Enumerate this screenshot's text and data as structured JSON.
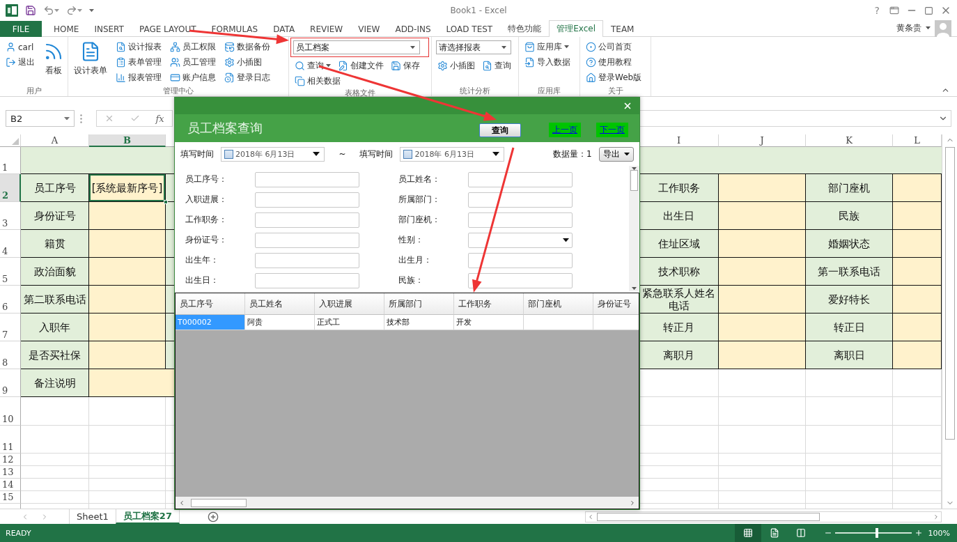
{
  "window": {
    "title": "Book1 - Excel",
    "help": "?"
  },
  "ribbon_tabs": [
    {
      "label": "FILE",
      "kind": "file",
      "selected": false
    },
    {
      "label": "HOME",
      "kind": "tab",
      "selected": false
    },
    {
      "label": "INSERT",
      "kind": "tab",
      "selected": false
    },
    {
      "label": "PAGE LAYOUT",
      "kind": "tab",
      "selected": false
    },
    {
      "label": "FORMULAS",
      "kind": "tab",
      "selected": false
    },
    {
      "label": "DATA",
      "kind": "tab",
      "selected": false
    },
    {
      "label": "REVIEW",
      "kind": "tab",
      "selected": false
    },
    {
      "label": "VIEW",
      "kind": "tab",
      "selected": false
    },
    {
      "label": "ADD-INS",
      "kind": "tab",
      "selected": false
    },
    {
      "label": "LOAD TEST",
      "kind": "tab",
      "selected": false
    },
    {
      "label": "特色功能",
      "kind": "tab",
      "selected": false
    },
    {
      "label": "管理Excel",
      "kind": "tab",
      "selected": true
    },
    {
      "label": "TEAM",
      "kind": "tab",
      "selected": false
    }
  ],
  "account": {
    "name": "黄条贵"
  },
  "ribbon_groups": [
    {
      "label": "用户",
      "columns": [
        [
          {
            "kind": "small",
            "label": "carl"
          },
          {
            "kind": "small",
            "label": "退出"
          }
        ],
        [
          {
            "kind": "large",
            "label": "看板"
          }
        ]
      ]
    },
    {
      "label": "管理中心",
      "columns": [
        [
          {
            "kind": "large",
            "label": "设计表单"
          }
        ],
        [
          {
            "kind": "small",
            "label": "设计报表"
          },
          {
            "kind": "small",
            "label": "表单管理"
          },
          {
            "kind": "small",
            "label": "报表管理"
          }
        ],
        [
          {
            "kind": "small",
            "label": "员工权限"
          },
          {
            "kind": "small",
            "label": "员工管理"
          },
          {
            "kind": "small",
            "label": "账户信息"
          }
        ],
        [
          {
            "kind": "small",
            "label": "数据备份"
          },
          {
            "kind": "small",
            "label": "小插图"
          },
          {
            "kind": "small",
            "label": "登录日志"
          }
        ]
      ]
    },
    {
      "label": "表格文件",
      "columns": [
        [
          {
            "kind": "dropdown",
            "value": "员工档案",
            "highlighted": true
          },
          {
            "kind": "row",
            "items": [
              {
                "kind": "split",
                "label": "查询"
              },
              {
                "kind": "small",
                "label": "创建文件"
              },
              {
                "kind": "small",
                "label": "保存"
              }
            ]
          },
          {
            "kind": "small",
            "label": "相关数据"
          }
        ]
      ]
    },
    {
      "label": "统计分析",
      "columns": [
        [
          {
            "kind": "dropdown",
            "value": "请选择报表",
            "highlighted": false
          },
          {
            "kind": "row",
            "items": [
              {
                "kind": "small",
                "label": "小插图"
              },
              {
                "kind": "small",
                "label": "查询"
              }
            ]
          }
        ]
      ]
    },
    {
      "label": "应用库",
      "columns": [
        [
          {
            "kind": "split",
            "label": "应用库"
          },
          {
            "kind": "small",
            "label": "导入数据"
          }
        ]
      ]
    },
    {
      "label": "关于",
      "columns": [
        [
          {
            "kind": "small",
            "label": "公司首页"
          },
          {
            "kind": "small",
            "label": "使用教程"
          },
          {
            "kind": "small",
            "label": "登录Web版"
          }
        ]
      ]
    }
  ],
  "formula_bar": {
    "name_box": "B2",
    "function_label": "fx"
  },
  "sheet": {
    "columns": [
      {
        "label": "A",
        "selected": false
      },
      {
        "label": "B",
        "selected": true
      },
      {
        "label": "I",
        "selected": false
      },
      {
        "label": "J",
        "selected": false
      },
      {
        "label": "K",
        "selected": false
      },
      {
        "label": "L",
        "selected": false
      }
    ],
    "rows": [
      {
        "number": "1",
        "kind": "band",
        "selected": false
      },
      {
        "number": "2",
        "kind": "form",
        "selected": true,
        "cells": [
          {
            "kind": "label",
            "text": "员工序号"
          },
          {
            "kind": "input",
            "text": "[系统最新序号]"
          },
          {
            "kind": "label",
            "text": "工作职务"
          },
          {
            "kind": "input"
          },
          {
            "kind": "label",
            "text": "部门座机"
          },
          {
            "kind": "input"
          }
        ]
      },
      {
        "number": "3",
        "kind": "form",
        "selected": false,
        "cells": [
          {
            "kind": "label",
            "text": "身份证号"
          },
          {
            "kind": "input"
          },
          {
            "kind": "label",
            "text": "出生日"
          },
          {
            "kind": "input"
          },
          {
            "kind": "label",
            "text": "民族"
          },
          {
            "kind": "input"
          }
        ]
      },
      {
        "number": "4",
        "kind": "form",
        "selected": false,
        "cells": [
          {
            "kind": "label",
            "text": "籍贯"
          },
          {
            "kind": "input"
          },
          {
            "kind": "label",
            "text": "住址区域"
          },
          {
            "kind": "input"
          },
          {
            "kind": "label",
            "text": "婚姻状态"
          },
          {
            "kind": "input"
          }
        ]
      },
      {
        "number": "5",
        "kind": "form",
        "selected": false,
        "cells": [
          {
            "kind": "label",
            "text": "政治面貌"
          },
          {
            "kind": "input"
          },
          {
            "kind": "label",
            "text": "技术职称"
          },
          {
            "kind": "input"
          },
          {
            "kind": "label",
            "text": "第一联系电话"
          },
          {
            "kind": "input"
          }
        ]
      },
      {
        "number": "6",
        "kind": "form",
        "selected": false,
        "cells": [
          {
            "kind": "label",
            "text": "第二联系电话"
          },
          {
            "kind": "input"
          },
          {
            "kind": "label",
            "text": "紧急联系人姓名电话"
          },
          {
            "kind": "input"
          },
          {
            "kind": "label",
            "text": "爱好特长"
          },
          {
            "kind": "input"
          }
        ]
      },
      {
        "number": "7",
        "kind": "form",
        "selected": false,
        "cells": [
          {
            "kind": "label",
            "text": "入职年"
          },
          {
            "kind": "input"
          },
          {
            "kind": "label",
            "text": "转正月"
          },
          {
            "kind": "input"
          },
          {
            "kind": "label",
            "text": "转正日"
          },
          {
            "kind": "input"
          }
        ]
      },
      {
        "number": "8",
        "kind": "form",
        "selected": false,
        "cells": [
          {
            "kind": "label",
            "text": "是否买社保"
          },
          {
            "kind": "input"
          },
          {
            "kind": "label",
            "text": "离职月"
          },
          {
            "kind": "input"
          },
          {
            "kind": "label",
            "text": "离职日"
          },
          {
            "kind": "input"
          }
        ]
      },
      {
        "number": "9",
        "kind": "note",
        "selected": false,
        "cells": [
          {
            "kind": "label",
            "text": "备注说明"
          },
          {
            "kind": "input"
          }
        ]
      },
      {
        "number": "10",
        "kind": "blank",
        "selected": false
      },
      {
        "number": "11",
        "kind": "blank",
        "selected": false
      },
      {
        "number": "12",
        "kind": "blank",
        "selected": false
      },
      {
        "number": "13",
        "kind": "blank",
        "selected": false
      },
      {
        "number": "14",
        "kind": "blank",
        "selected": false
      },
      {
        "number": "15",
        "kind": "blank",
        "selected": false
      }
    ]
  },
  "dialog": {
    "title": "员工档案查询",
    "query_button": "查询",
    "prev_link": "上一页",
    "next_link": "下一页",
    "date_from": {
      "label": "填写时间",
      "value": "2018年 6月13日",
      "checked": false
    },
    "separator": "~",
    "date_to": {
      "label": "填写时间",
      "value": "2018年 6月13日",
      "checked": false
    },
    "count": "数据量：1",
    "export_button": "导出",
    "fields": [
      {
        "label": "员工序号：",
        "kind": "text"
      },
      {
        "label": "员工姓名：",
        "kind": "text"
      },
      {
        "label": "入职进展：",
        "kind": "text"
      },
      {
        "label": "所属部门：",
        "kind": "text"
      },
      {
        "label": "工作职务：",
        "kind": "text"
      },
      {
        "label": "部门座机：",
        "kind": "text"
      },
      {
        "label": "身份证号：",
        "kind": "text"
      },
      {
        "label": "性别：",
        "kind": "select"
      },
      {
        "label": "出生年：",
        "kind": "text"
      },
      {
        "label": "出生月：",
        "kind": "text"
      },
      {
        "label": "出生日：",
        "kind": "text"
      },
      {
        "label": "民族：",
        "kind": "text"
      }
    ],
    "results": {
      "columns": [
        "员工序号",
        "员工姓名",
        "入职进展",
        "所属部门",
        "工作职务",
        "部门座机",
        "身份证号"
      ],
      "rows": [
        {
          "cells": [
            {
              "text": "T000002",
              "selected": true
            },
            {
              "text": "阿贵",
              "selected": false
            },
            {
              "text": "正式工",
              "selected": false
            },
            {
              "text": "技术部",
              "selected": false
            },
            {
              "text": "开发",
              "selected": false
            }
          ]
        }
      ]
    }
  },
  "sheet_tabs": [
    {
      "label": "Sheet1",
      "selected": false
    },
    {
      "label": "员工档案27",
      "selected": true
    }
  ],
  "status_bar": {
    "status": "READY",
    "views": [
      {
        "kind": "normal",
        "selected": true
      },
      {
        "kind": "page_layout",
        "selected": false
      },
      {
        "kind": "page_break",
        "selected": false
      }
    ],
    "zoom_slider": {
      "level": 0.55
    },
    "zoom": "100%"
  },
  "annotations": [
    {
      "kind": "arrow"
    },
    {
      "kind": "arrow"
    },
    {
      "kind": "arrow"
    }
  ]
}
